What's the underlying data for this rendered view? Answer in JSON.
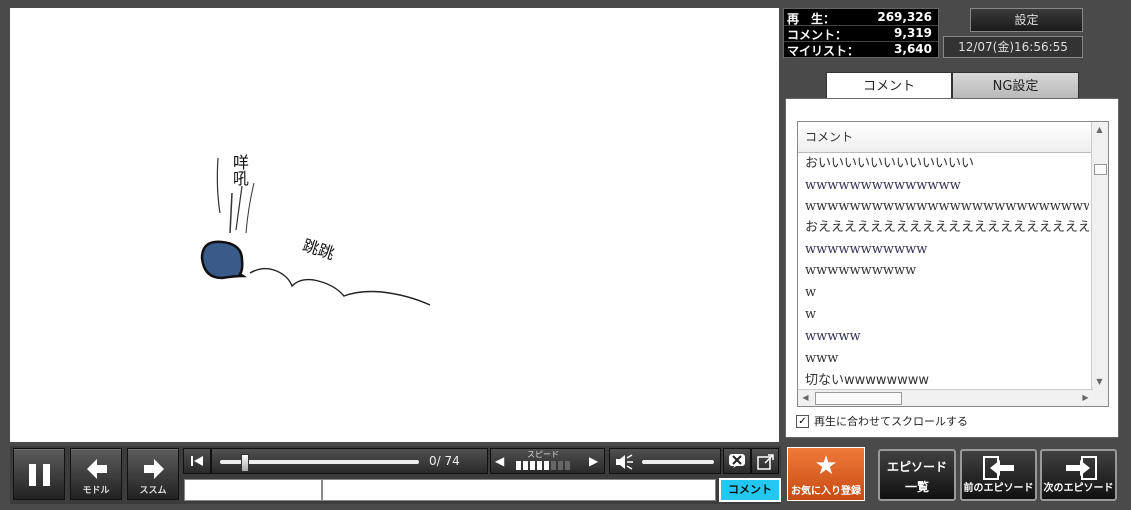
{
  "stats": {
    "play_label": "再　生：",
    "play_value": "269,326",
    "comment_label": "コメント：",
    "comment_value": "9,319",
    "mylist_label": "マイリスト：",
    "mylist_value": "3,640"
  },
  "header": {
    "settings_label": "設定",
    "datetime": "12/07(金)16:56:55"
  },
  "tabs": [
    {
      "label": "コメント",
      "active": true
    },
    {
      "label": "NG設定",
      "active": false
    }
  ],
  "comment_list": {
    "column_header": "コメント",
    "items": [
      "おいいいいいいいいいいいい",
      "wwwwwwwwwwwwww",
      "wwwwwwwwwwwwwwwwwwwwwwwwwwww",
      "おえええええええええええええええええええええ",
      "wwwwwwwwwww",
      "wwwwwwwwww",
      "w",
      "w",
      "wwwww",
      "www",
      "切ないwwwwwwww"
    ]
  },
  "autoscroll": {
    "label": "再生に合わせてスクロールする",
    "checked": true
  },
  "video": {
    "label_roar": "咩吼",
    "label_jump": "跳跳"
  },
  "controls": {
    "back_label": "モドル",
    "forward_label": "ススム",
    "time_display": "0/ 74",
    "speed_label": "スピード",
    "comment_button_label": "コメント"
  },
  "episode_buttons": {
    "favorite_label": "お気に入り登録",
    "episode_list_label_1": "エピソード",
    "episode_list_label_2": "一覧",
    "prev_episode_label": "前のエピソード",
    "next_episode_label": "次のエピソード"
  },
  "colors": {
    "accent_cyan": "#22c8f0",
    "favorite_orange": "#e8622a",
    "blob_blue": "#3a5a8a"
  }
}
